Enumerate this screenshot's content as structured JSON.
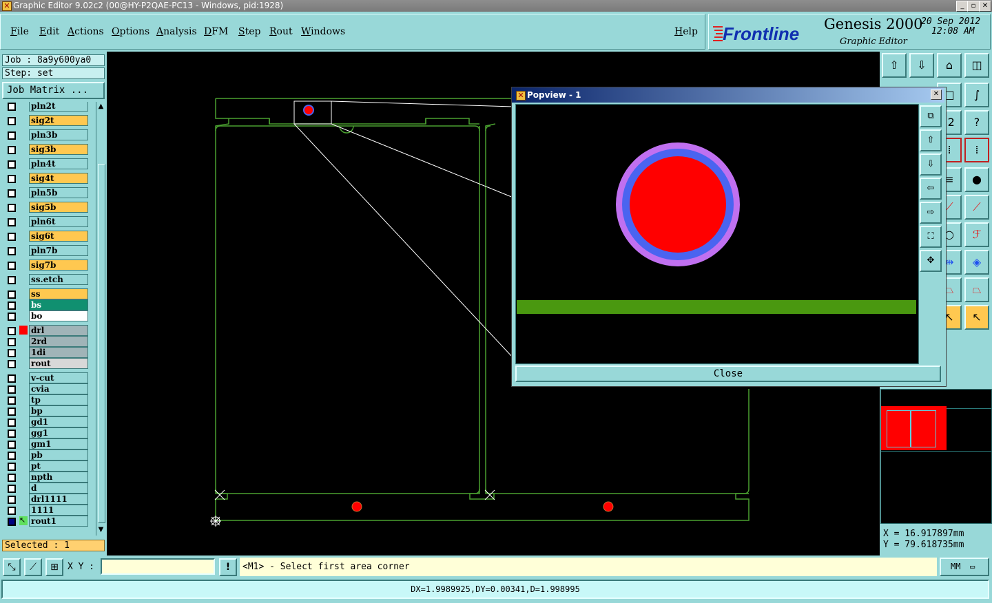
{
  "window": {
    "title": "Graphic Editor 9.02c2 (00@HY-P2QAE-PC13 - Windows, pid:1928)",
    "min_label": "_",
    "max_label": "▫",
    "close_label": "✕"
  },
  "menu": {
    "items": [
      "File",
      "Edit",
      "Actions",
      "Options",
      "Analysis",
      "DFM",
      "Step",
      "Rout",
      "Windows"
    ],
    "help": "Help"
  },
  "brand": {
    "logo": "Frontline",
    "product": "Genesis 2000",
    "subtitle": "Graphic Editor",
    "date": "20 Sep 2012",
    "time": "12:08 AM"
  },
  "job": {
    "job_label": "Job : 8a9y600ya0",
    "step_label": "Step: set",
    "matrix_button": "Job Matrix ..."
  },
  "layers": [
    {
      "name": "pln2t",
      "bg": "#98d8d8"
    },
    {
      "name": "sig2t",
      "bg": "#ffc850"
    },
    {
      "name": "pln3b",
      "bg": "#98d8d8"
    },
    {
      "name": "sig3b",
      "bg": "#ffc850"
    },
    {
      "name": "pln4t",
      "bg": "#98d8d8"
    },
    {
      "name": "sig4t",
      "bg": "#ffc850"
    },
    {
      "name": "pln5b",
      "bg": "#98d8d8"
    },
    {
      "name": "sig5b",
      "bg": "#ffc850"
    },
    {
      "name": "pln6t",
      "bg": "#98d8d8"
    },
    {
      "name": "sig6t",
      "bg": "#ffc850"
    },
    {
      "name": "pln7b",
      "bg": "#98d8d8"
    },
    {
      "name": "sig7b",
      "bg": "#ffc850"
    },
    {
      "name": "ss.etch",
      "bg": "#98d8d8"
    },
    {
      "name": "ss",
      "bg": "#ffc850"
    },
    {
      "name": "bs",
      "bg": "#109070"
    },
    {
      "name": "bo",
      "bg": "#ffffff"
    },
    {
      "name": "drl",
      "bg": "#a0b4b8",
      "swatch": "#ff0000"
    },
    {
      "name": "2rd",
      "bg": "#a0b4b8"
    },
    {
      "name": "1di",
      "bg": "#a0b4b8"
    },
    {
      "name": "rout",
      "bg": "#d8d8d8"
    },
    {
      "name": "v-cut",
      "bg": "#98d8d8"
    },
    {
      "name": "cvia",
      "bg": "#98d8d8"
    },
    {
      "name": "tp",
      "bg": "#98d8d8"
    },
    {
      "name": "bp",
      "bg": "#98d8d8"
    },
    {
      "name": "gd1",
      "bg": "#98d8d8"
    },
    {
      "name": "gg1",
      "bg": "#98d8d8"
    },
    {
      "name": "gm1",
      "bg": "#98d8d8"
    },
    {
      "name": "pb",
      "bg": "#98d8d8"
    },
    {
      "name": "pt",
      "bg": "#98d8d8"
    },
    {
      "name": "npth",
      "bg": "#98d8d8"
    },
    {
      "name": "d",
      "bg": "#98d8d8"
    },
    {
      "name": "drl1111",
      "bg": "#98d8d8"
    },
    {
      "name": "1111",
      "bg": "#98d8d8"
    },
    {
      "name": "rout1",
      "bg": "#98d8d8",
      "swatch": "#ffffff",
      "work": true
    }
  ],
  "selected": "Selected : 1",
  "popview": {
    "title": "Popview - 1",
    "close_button": "Close"
  },
  "coords": {
    "x": "X =  16.917897mm",
    "y": "Y =  79.618735mm"
  },
  "command": {
    "xy_label": "X Y :",
    "prompt": "<M1> - Select first area corner",
    "units": "MM"
  },
  "status": "DX=1.9989925,DY=0.00341,D=1.998995",
  "colors": {
    "board_outline": "#4aa030",
    "pad_outer": "#c070f0",
    "pad_mid": "#4a64f0",
    "pad_inner": "#ff0000",
    "trace": "#4a9810"
  }
}
